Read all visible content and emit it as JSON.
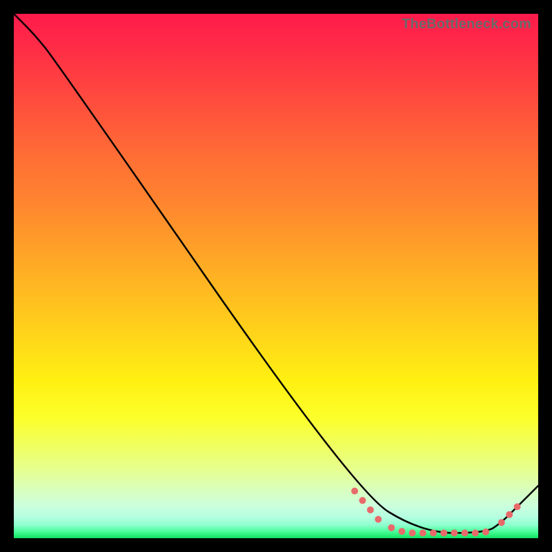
{
  "attribution": "TheBottleneck.com",
  "chart_data": {
    "type": "line",
    "title": "",
    "xlabel": "",
    "ylabel": "",
    "xlim": [
      0,
      100
    ],
    "ylim": [
      0,
      100
    ],
    "series": [
      {
        "name": "bottleneck-curve",
        "x": [
          0,
          4,
          8,
          65,
          78,
          90,
          93,
          96,
          100
        ],
        "y": [
          100,
          96,
          91,
          9,
          1,
          1,
          3,
          6,
          10
        ]
      }
    ],
    "markers": {
      "name": "highlight-dots",
      "color": "#e86a6a",
      "points": [
        {
          "x": 65,
          "y": 9.0,
          "r": 5
        },
        {
          "x": 66.5,
          "y": 7.2,
          "r": 5
        },
        {
          "x": 68,
          "y": 5.4,
          "r": 5
        },
        {
          "x": 69.5,
          "y": 3.6,
          "r": 5
        },
        {
          "x": 72,
          "y": 2.0,
          "r": 5
        },
        {
          "x": 74,
          "y": 1.3,
          "r": 5
        },
        {
          "x": 76,
          "y": 1.0,
          "r": 5
        },
        {
          "x": 78,
          "y": 1.0,
          "r": 5
        },
        {
          "x": 80,
          "y": 1.0,
          "r": 5
        },
        {
          "x": 82,
          "y": 1.0,
          "r": 5
        },
        {
          "x": 84,
          "y": 1.0,
          "r": 5
        },
        {
          "x": 86,
          "y": 1.0,
          "r": 5
        },
        {
          "x": 88,
          "y": 1.0,
          "r": 5
        },
        {
          "x": 90,
          "y": 1.2,
          "r": 5
        },
        {
          "x": 93,
          "y": 3.0,
          "r": 5
        },
        {
          "x": 94.5,
          "y": 4.5,
          "r": 5
        },
        {
          "x": 96,
          "y": 6.0,
          "r": 5
        }
      ]
    },
    "colors": {
      "curve": "#000000",
      "marker": "#e86a6a",
      "gradient_top": "#ff1a4b",
      "gradient_bottom": "#10e060"
    }
  }
}
